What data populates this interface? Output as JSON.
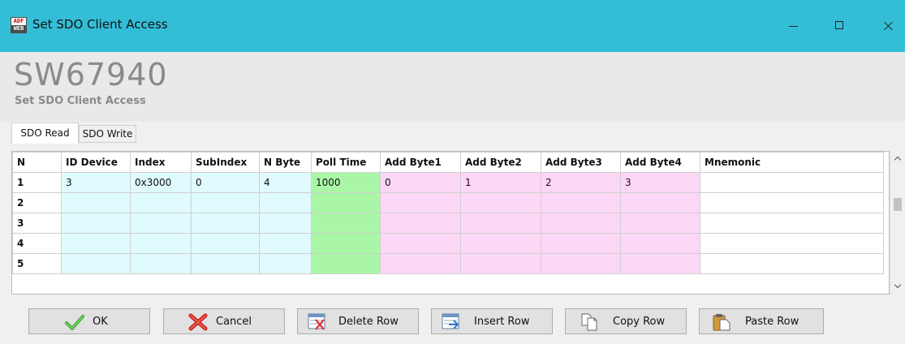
{
  "window": {
    "title": "Set SDO Client Access",
    "app_icon_top": "ADF",
    "app_icon_bottom": "WEB"
  },
  "header": {
    "title": "SW67940",
    "subtitle": "Set SDO Client Access"
  },
  "tabs": [
    {
      "label": "SDO Read",
      "active": true
    },
    {
      "label": "SDO Write",
      "active": false
    }
  ],
  "table": {
    "columns": [
      "N",
      "ID Device",
      "Index",
      "SubIndex",
      "N Byte",
      "Poll Time",
      "Add Byte1",
      "Add Byte2",
      "Add Byte3",
      "Add Byte4",
      "Mnemonic"
    ],
    "rows": [
      [
        "1",
        "3",
        "0x3000",
        "0",
        "4",
        "1000",
        "0",
        "1",
        "2",
        "3",
        ""
      ],
      [
        "2",
        "",
        "",
        "",
        "",
        "",
        "",
        "",
        "",
        "",
        ""
      ],
      [
        "3",
        "",
        "",
        "",
        "",
        "",
        "",
        "",
        "",
        "",
        ""
      ],
      [
        "4",
        "",
        "",
        "",
        "",
        "",
        "",
        "",
        "",
        "",
        ""
      ],
      [
        "5",
        "",
        "",
        "",
        "",
        "",
        "",
        "",
        "",
        "",
        ""
      ]
    ]
  },
  "buttons": {
    "ok": "OK",
    "cancel": "Cancel",
    "delete_row": "Delete Row",
    "insert_row": "Insert Row",
    "copy_row": "Copy Row",
    "paste_row": "Paste Row"
  },
  "colors": {
    "titlebar": "#34bdd6",
    "cell_blue": "#e0fbfd",
    "cell_green": "#a9f7a6",
    "cell_pink": "#fcd7f5"
  }
}
